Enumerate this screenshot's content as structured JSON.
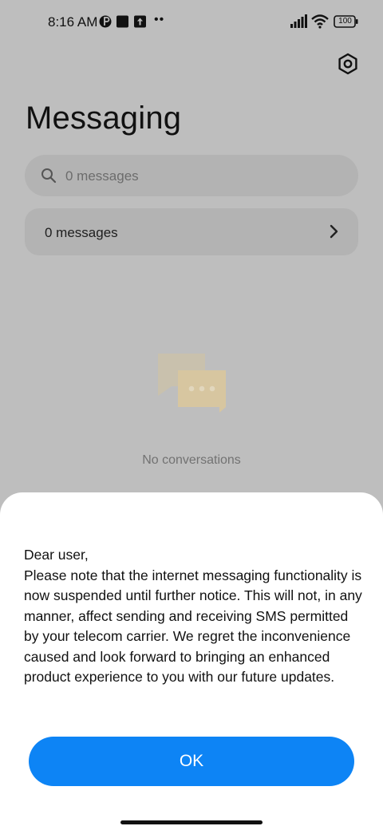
{
  "status_bar": {
    "time": "8:16 AM",
    "battery": "100"
  },
  "header": {
    "title": "Messaging",
    "settings_icon": "gear-icon"
  },
  "search": {
    "placeholder": "0 messages"
  },
  "messages_row": {
    "label": "0 messages"
  },
  "empty_state": {
    "text": "No conversations"
  },
  "dialog": {
    "message": "Dear user,\nPlease note that the internet messaging functionality is now suspended until further notice. This will not, in any manner, affect sending and receiving SMS permitted by your telecom carrier. We regret the inconvenience caused and look forward to bringing an enhanced product experience to you with our future updates.",
    "ok_label": "OK"
  },
  "colors": {
    "accent": "#0d84f5",
    "overlay_background": "#bebebe",
    "dialog_background": "#ffffff"
  }
}
